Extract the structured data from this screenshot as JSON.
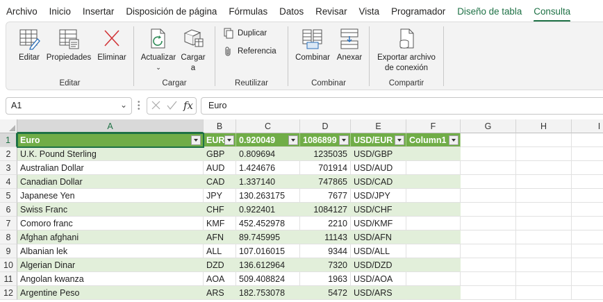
{
  "menu": {
    "items": [
      "Archivo",
      "Inicio",
      "Insertar",
      "Disposición de página",
      "Fórmulas",
      "Datos",
      "Revisar",
      "Vista",
      "Programador",
      "Diseño de tabla",
      "Consulta"
    ]
  },
  "ribbon": {
    "groups": {
      "editar": {
        "label": "Editar",
        "buttons": [
          "Editar",
          "Propiedades",
          "Eliminar"
        ]
      },
      "cargar": {
        "label": "Cargar",
        "actualizar": "Actualizar",
        "cargar_a_1": "Cargar",
        "cargar_a_2": "a"
      },
      "reutilizar": {
        "label": "Reutilizar",
        "duplicar": "Duplicar",
        "referencia": "Referencia"
      },
      "combinar": {
        "label": "Combinar",
        "combinar": "Combinar",
        "anexar": "Anexar"
      },
      "compartir": {
        "label": "Compartir",
        "exportar_1": "Exportar archivo",
        "exportar_2": "de conexión"
      }
    }
  },
  "formula_bar": {
    "name_box": "A1",
    "fx": "fx",
    "formula": "Euro"
  },
  "columns": [
    "A",
    "B",
    "C",
    "D",
    "E",
    "F",
    "G",
    "H",
    "I"
  ],
  "rows": [
    "1",
    "2",
    "3",
    "4",
    "5",
    "6",
    "7",
    "8",
    "9",
    "10",
    "11",
    "12"
  ],
  "table": {
    "headers": [
      "Euro",
      "EUR",
      "0.920049",
      "1086899",
      "USD/EUR",
      "Column1"
    ],
    "data": [
      [
        "U.K. Pound Sterling",
        "GBP",
        "0.809694",
        "1235035",
        "USD/GBP"
      ],
      [
        "Australian Dollar",
        "AUD",
        "1.424676",
        "701914",
        "USD/AUD"
      ],
      [
        "Canadian Dollar",
        "CAD",
        "1.337140",
        "747865",
        "USD/CAD"
      ],
      [
        "Japanese Yen",
        "JPY",
        "130.263175",
        "7677",
        "USD/JPY"
      ],
      [
        "Swiss Franc",
        "CHF",
        "0.922401",
        "1084127",
        "USD/CHF"
      ],
      [
        "Comoro franc",
        "KMF",
        "452.452978",
        "2210",
        "USD/KMF"
      ],
      [
        "Afghan afghani",
        "AFN",
        "89.745995",
        "11143",
        "USD/AFN"
      ],
      [
        "Albanian lek",
        "ALL",
        "107.016015",
        "9344",
        "USD/ALL"
      ],
      [
        "Algerian Dinar",
        "DZD",
        "136.612964",
        "7320",
        "USD/DZD"
      ],
      [
        "Angolan kwanza",
        "AOA",
        "509.408824",
        "1963",
        "USD/AOA"
      ],
      [
        "Argentine Peso",
        "ARS",
        "182.753078",
        "5472",
        "USD/ARS"
      ]
    ]
  },
  "colors": {
    "accent": "#1e7145",
    "table_header": "#70ad47",
    "table_band": "#e2efda"
  }
}
